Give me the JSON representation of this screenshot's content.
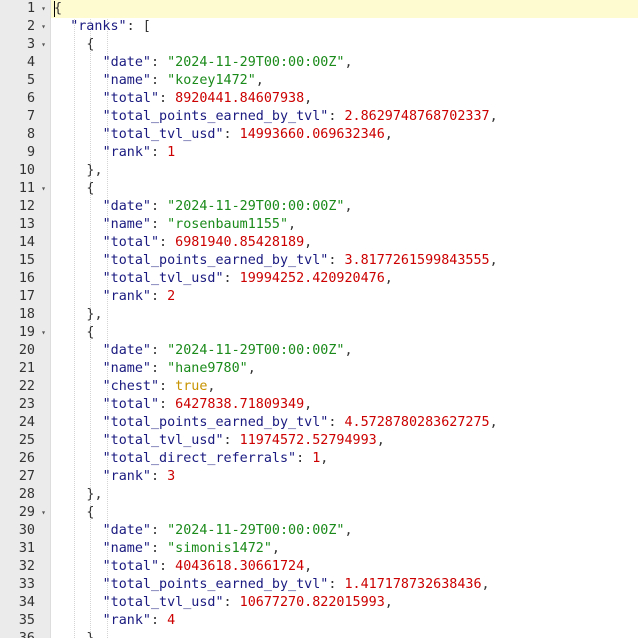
{
  "editor": {
    "colors": {
      "key": "#1a1a80",
      "string": "#1a8a1a",
      "number": "#cc0000",
      "boolean": "#c79300",
      "punctuation": "#333333",
      "gutter_bg": "#ebebeb",
      "active_line_bg": "#fffbd1"
    },
    "lines": [
      {
        "n": "1",
        "fold": true,
        "indent": 0,
        "parts": [
          [
            "p",
            "{"
          ]
        ]
      },
      {
        "n": "2",
        "fold": true,
        "indent": 1,
        "parts": [
          [
            "k",
            "\"ranks\""
          ],
          [
            "p",
            ": ["
          ]
        ]
      },
      {
        "n": "3",
        "fold": true,
        "indent": 2,
        "parts": [
          [
            "p",
            "{"
          ]
        ]
      },
      {
        "n": "4",
        "indent": 3,
        "parts": [
          [
            "k",
            "\"date\""
          ],
          [
            "p",
            ": "
          ],
          [
            "s",
            "\"2024-11-29T00:00:00Z\""
          ],
          [
            "p",
            ","
          ]
        ]
      },
      {
        "n": "5",
        "indent": 3,
        "parts": [
          [
            "k",
            "\"name\""
          ],
          [
            "p",
            ": "
          ],
          [
            "s",
            "\"kozey1472\""
          ],
          [
            "p",
            ","
          ]
        ]
      },
      {
        "n": "6",
        "indent": 3,
        "parts": [
          [
            "k",
            "\"total\""
          ],
          [
            "p",
            ": "
          ],
          [
            "n",
            "8920441.84607938"
          ],
          [
            "p",
            ","
          ]
        ]
      },
      {
        "n": "7",
        "indent": 3,
        "parts": [
          [
            "k",
            "\"total_points_earned_by_tvl\""
          ],
          [
            "p",
            ": "
          ],
          [
            "n",
            "2.8629748768702337"
          ],
          [
            "p",
            ","
          ]
        ]
      },
      {
        "n": "8",
        "indent": 3,
        "parts": [
          [
            "k",
            "\"total_tvl_usd\""
          ],
          [
            "p",
            ": "
          ],
          [
            "n",
            "14993660.069632346"
          ],
          [
            "p",
            ","
          ]
        ]
      },
      {
        "n": "9",
        "indent": 3,
        "parts": [
          [
            "k",
            "\"rank\""
          ],
          [
            "p",
            ": "
          ],
          [
            "n",
            "1"
          ]
        ]
      },
      {
        "n": "10",
        "indent": 2,
        "parts": [
          [
            "p",
            "},"
          ]
        ]
      },
      {
        "n": "11",
        "fold": true,
        "indent": 2,
        "parts": [
          [
            "p",
            "{"
          ]
        ]
      },
      {
        "n": "12",
        "indent": 3,
        "parts": [
          [
            "k",
            "\"date\""
          ],
          [
            "p",
            ": "
          ],
          [
            "s",
            "\"2024-11-29T00:00:00Z\""
          ],
          [
            "p",
            ","
          ]
        ]
      },
      {
        "n": "13",
        "indent": 3,
        "parts": [
          [
            "k",
            "\"name\""
          ],
          [
            "p",
            ": "
          ],
          [
            "s",
            "\"rosenbaum1155\""
          ],
          [
            "p",
            ","
          ]
        ]
      },
      {
        "n": "14",
        "indent": 3,
        "parts": [
          [
            "k",
            "\"total\""
          ],
          [
            "p",
            ": "
          ],
          [
            "n",
            "6981940.85428189"
          ],
          [
            "p",
            ","
          ]
        ]
      },
      {
        "n": "15",
        "indent": 3,
        "parts": [
          [
            "k",
            "\"total_points_earned_by_tvl\""
          ],
          [
            "p",
            ": "
          ],
          [
            "n",
            "3.8177261599843555"
          ],
          [
            "p",
            ","
          ]
        ]
      },
      {
        "n": "16",
        "indent": 3,
        "parts": [
          [
            "k",
            "\"total_tvl_usd\""
          ],
          [
            "p",
            ": "
          ],
          [
            "n",
            "19994252.420920476"
          ],
          [
            "p",
            ","
          ]
        ]
      },
      {
        "n": "17",
        "indent": 3,
        "parts": [
          [
            "k",
            "\"rank\""
          ],
          [
            "p",
            ": "
          ],
          [
            "n",
            "2"
          ]
        ]
      },
      {
        "n": "18",
        "indent": 2,
        "parts": [
          [
            "p",
            "},"
          ]
        ]
      },
      {
        "n": "19",
        "fold": true,
        "indent": 2,
        "parts": [
          [
            "p",
            "{"
          ]
        ]
      },
      {
        "n": "20",
        "indent": 3,
        "parts": [
          [
            "k",
            "\"date\""
          ],
          [
            "p",
            ": "
          ],
          [
            "s",
            "\"2024-11-29T00:00:00Z\""
          ],
          [
            "p",
            ","
          ]
        ]
      },
      {
        "n": "21",
        "indent": 3,
        "parts": [
          [
            "k",
            "\"name\""
          ],
          [
            "p",
            ": "
          ],
          [
            "s",
            "\"hane9780\""
          ],
          [
            "p",
            ","
          ]
        ]
      },
      {
        "n": "22",
        "indent": 3,
        "parts": [
          [
            "k",
            "\"chest\""
          ],
          [
            "p",
            ": "
          ],
          [
            "b",
            "true"
          ],
          [
            "p",
            ","
          ]
        ]
      },
      {
        "n": "23",
        "indent": 3,
        "parts": [
          [
            "k",
            "\"total\""
          ],
          [
            "p",
            ": "
          ],
          [
            "n",
            "6427838.71809349"
          ],
          [
            "p",
            ","
          ]
        ]
      },
      {
        "n": "24",
        "indent": 3,
        "parts": [
          [
            "k",
            "\"total_points_earned_by_tvl\""
          ],
          [
            "p",
            ": "
          ],
          [
            "n",
            "4.5728780283627275"
          ],
          [
            "p",
            ","
          ]
        ]
      },
      {
        "n": "25",
        "indent": 3,
        "parts": [
          [
            "k",
            "\"total_tvl_usd\""
          ],
          [
            "p",
            ": "
          ],
          [
            "n",
            "11974572.52794993"
          ],
          [
            "p",
            ","
          ]
        ]
      },
      {
        "n": "26",
        "indent": 3,
        "parts": [
          [
            "k",
            "\"total_direct_referrals\""
          ],
          [
            "p",
            ": "
          ],
          [
            "n",
            "1"
          ],
          [
            "p",
            ","
          ]
        ]
      },
      {
        "n": "27",
        "indent": 3,
        "parts": [
          [
            "k",
            "\"rank\""
          ],
          [
            "p",
            ": "
          ],
          [
            "n",
            "3"
          ]
        ]
      },
      {
        "n": "28",
        "indent": 2,
        "parts": [
          [
            "p",
            "},"
          ]
        ]
      },
      {
        "n": "29",
        "fold": true,
        "indent": 2,
        "parts": [
          [
            "p",
            "{"
          ]
        ]
      },
      {
        "n": "30",
        "indent": 3,
        "parts": [
          [
            "k",
            "\"date\""
          ],
          [
            "p",
            ": "
          ],
          [
            "s",
            "\"2024-11-29T00:00:00Z\""
          ],
          [
            "p",
            ","
          ]
        ]
      },
      {
        "n": "31",
        "indent": 3,
        "parts": [
          [
            "k",
            "\"name\""
          ],
          [
            "p",
            ": "
          ],
          [
            "s",
            "\"simonis1472\""
          ],
          [
            "p",
            ","
          ]
        ]
      },
      {
        "n": "32",
        "indent": 3,
        "parts": [
          [
            "k",
            "\"total\""
          ],
          [
            "p",
            ": "
          ],
          [
            "n",
            "4043618.30661724"
          ],
          [
            "p",
            ","
          ]
        ]
      },
      {
        "n": "33",
        "indent": 3,
        "parts": [
          [
            "k",
            "\"total_points_earned_by_tvl\""
          ],
          [
            "p",
            ": "
          ],
          [
            "n",
            "1.417178732638436"
          ],
          [
            "p",
            ","
          ]
        ]
      },
      {
        "n": "34",
        "indent": 3,
        "parts": [
          [
            "k",
            "\"total_tvl_usd\""
          ],
          [
            "p",
            ": "
          ],
          [
            "n",
            "10677270.822015993"
          ],
          [
            "p",
            ","
          ]
        ]
      },
      {
        "n": "35",
        "indent": 3,
        "parts": [
          [
            "k",
            "\"rank\""
          ],
          [
            "p",
            ": "
          ],
          [
            "n",
            "4"
          ]
        ]
      },
      {
        "n": "36",
        "indent": 2,
        "parts": [
          [
            "p",
            "},"
          ]
        ]
      }
    ]
  }
}
